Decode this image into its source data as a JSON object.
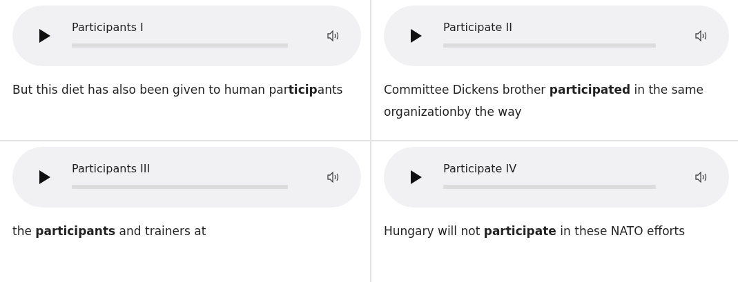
{
  "examples": [
    {
      "title": "Participants I",
      "sentence": "But this diet has also been given to human par**ticip**ants"
    },
    {
      "title": "Participate II",
      "sentence": "Committee Dickens brother **participated** in the same organizationby the way"
    },
    {
      "title": "Participants III",
      "sentence": "the **participants** and trainers at"
    },
    {
      "title": "Participate IV",
      "sentence": "Hungary will not **participate** in these NATO efforts"
    }
  ]
}
